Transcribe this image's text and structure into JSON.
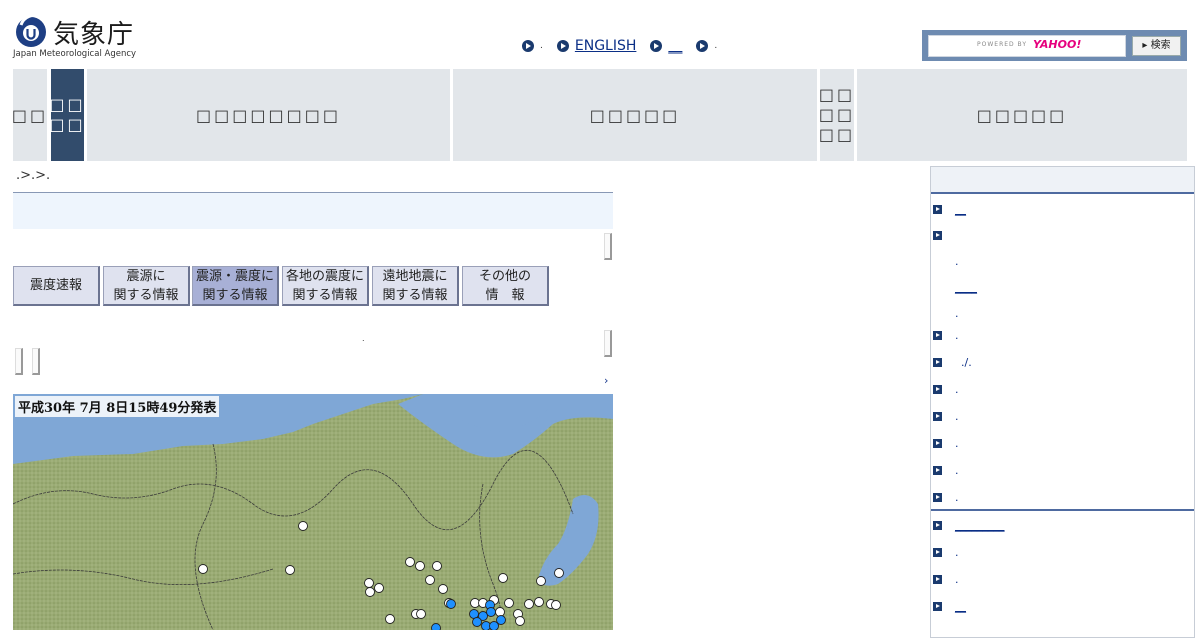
{
  "header": {
    "logo_text": "気象庁",
    "logo_sub": "Japan Meteorological Agency",
    "top_links": [
      {
        "label": ".",
        "link": false
      },
      {
        "label": "ENGLISH",
        "link": true
      },
      {
        "label": "__",
        "link": true
      },
      {
        "label": ".",
        "link": false
      }
    ],
    "search": {
      "powered_by": "POWERED BY",
      "brand": "YAHOO!",
      "button_label": "▸ 検索"
    }
  },
  "nav": [
    {
      "label": "□□"
    },
    {
      "label": "□□\n□□",
      "active": true
    },
    {
      "label": "□□□□□□□□"
    },
    {
      "label": "□□□□□"
    },
    {
      "label": "□□\n□□\n□□"
    },
    {
      "label": "□□□□□"
    }
  ],
  "breadcrumb": ".>.>.",
  "tabs": [
    {
      "label": "震度速報"
    },
    {
      "label": "震源に\n関する情報"
    },
    {
      "label": "震源・震度に\n関する情報",
      "active": true
    },
    {
      "label": "各地の震度に\n関する情報"
    },
    {
      "label": "遠地地震に\n関する情報"
    },
    {
      "label": "その他の\n情　報"
    }
  ],
  "small_dot": ".",
  "arrow": "›",
  "map": {
    "stamp": "平成30年 7月 8日15時49分発表",
    "colors": {
      "land": "#9fb07a",
      "sea": "#7fa7d6",
      "quake_blue": "#1e90ff",
      "quake_white": "#ffffff"
    }
  },
  "sidebar": {
    "items": [
      {
        "label": "__",
        "icon": true,
        "link": true
      },
      {
        "label": "",
        "icon": true,
        "link": false
      },
      {
        "label": ".",
        "icon": false,
        "link": false
      },
      {
        "label": "____",
        "icon": false,
        "link": true
      },
      {
        "label": ".",
        "icon": false,
        "link": false
      },
      {
        "label": ".",
        "icon": true,
        "link": false
      },
      {
        "label": "./.",
        "icon": true,
        "link": false
      },
      {
        "label": ".",
        "icon": true,
        "link": false
      },
      {
        "label": ".",
        "icon": true,
        "link": false
      },
      {
        "label": ".",
        "icon": true,
        "link": false
      },
      {
        "label": ".",
        "icon": true,
        "link": false
      },
      {
        "label": ".",
        "icon": true,
        "link": false
      },
      {
        "label": "_________",
        "icon": true,
        "link": true
      },
      {
        "label": ".",
        "icon": true,
        "link": false
      },
      {
        "label": ".",
        "icon": true,
        "link": false
      },
      {
        "label": "__",
        "icon": true,
        "link": true
      }
    ]
  }
}
